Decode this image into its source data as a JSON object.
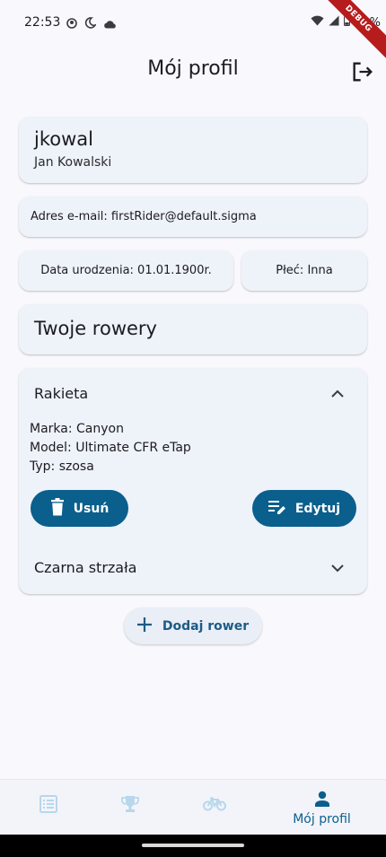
{
  "status_bar": {
    "time": "22:53",
    "battery": "25%",
    "debug_label": "DEBUG",
    "icons": [
      "face-icon",
      "night-icon",
      "cloud-icon",
      "wifi-icon",
      "signal-icon",
      "battery-icon"
    ]
  },
  "app_bar": {
    "title": "Mój profil",
    "logout_icon": "logout-icon"
  },
  "user": {
    "username": "jkowal",
    "full_name": "Jan Kowalski"
  },
  "email": {
    "text": "Adres e-mail: firstRider@default.sigma"
  },
  "birth_date": {
    "text": "Data urodzenia: 01.01.1900r."
  },
  "gender": {
    "text": "Płeć: Inna"
  },
  "bikes_section": {
    "title": "Twoje rowery"
  },
  "bikes": [
    {
      "name": "Rakieta",
      "expanded": true,
      "brand": "Marka: Canyon",
      "model": "Model: Ultimate CFR eTap",
      "type": "Typ: szosa",
      "delete_label": "Usuń",
      "edit_label": "Edytuj"
    },
    {
      "name": "Czarna strzała",
      "expanded": false
    }
  ],
  "add_bike": {
    "label": "Dodaj rower"
  },
  "bottom_nav": {
    "items": [
      {
        "icon": "list-icon",
        "label": ""
      },
      {
        "icon": "trophy-icon",
        "label": ""
      },
      {
        "icon": "bike-icon",
        "label": ""
      },
      {
        "icon": "person-icon",
        "label": "Mój profil",
        "active": true
      }
    ]
  },
  "colors": {
    "accent": "#0a5f8d",
    "card": "#eef2f9",
    "background": "#f9f9fd",
    "inactive_nav": "#b7d7ec"
  }
}
